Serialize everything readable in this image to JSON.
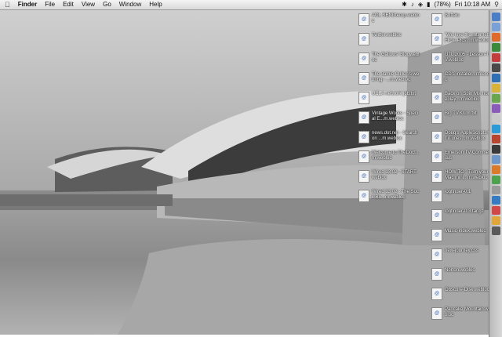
{
  "menubar": {
    "app_name": "Finder",
    "menus": [
      "File",
      "Edit",
      "View",
      "Go",
      "Window",
      "Help"
    ],
    "battery": "(78%)",
    "clock": "Fri 10:18 AM"
  },
  "desktop_icons": [
    {
      "name": "AOL SENDtemp.webloc",
      "col": 0,
      "row": 0
    },
    {
      "name": "Twitter.webloc",
      "col": 0,
      "row": 1
    },
    {
      "name": "The Gallows' Blogwebloc",
      "col": 0,
      "row": 2
    },
    {
      "name": "The Jamie Cullen's webring - ...m.webloc",
      "col": 0,
      "row": 3
    },
    {
      "name": "UCLA network job.txt",
      "col": 0,
      "row": 4
    },
    {
      "name": "Vintage Works - Special E...m.webloc",
      "col": 0,
      "row": 5
    },
    {
      "name": "news.dot.net - Search on ...m.webloc",
      "col": 0,
      "row": 6
    },
    {
      "name": "Welcome to TheDoct...m.webloc",
      "col": 0,
      "row": 7
    },
    {
      "name": "Wired 13.02 - START.webloc",
      "col": 0,
      "row": 8
    },
    {
      "name": "Wired 13.02 - The Sock Bu...m.webloc",
      "col": 0,
      "row": 9
    },
    {
      "name": "Buffalo",
      "col": 1,
      "row": 0
    },
    {
      "name": "\"We love the internet\" Flickr Pics...m.webloc",
      "col": 1,
      "row": 1
    },
    {
      "name": "UTL 2005 - Lesson-TV.webloc",
      "col": 1,
      "row": 2
    },
    {
      "name": "CD's installer...nfiler.doc",
      "col": 1,
      "row": 3
    },
    {
      "name": "Back on Spin Mix homeplay...m.webloc",
      "col": 1,
      "row": 4
    },
    {
      "name": "Big TV.Klum.txt",
      "col": 1,
      "row": 5
    },
    {
      "name": "Doug's AppleScripts for iTunes...m.webloc",
      "col": 1,
      "row": 6
    },
    {
      "name": "Emerson TV Commercials",
      "col": 1,
      "row": 7
    },
    {
      "name": "HOW-TO - Turn your Mac mini...m.webloc",
      "col": 1,
      "row": 8
    },
    {
      "name": "logfinder-0.1",
      "col": 1,
      "row": 9
    },
    {
      "name": "logfinder-0.3.tar.gz",
      "col": 1,
      "row": 10
    },
    {
      "name": "Music-index.webloc",
      "col": 1,
      "row": 11
    },
    {
      "name": "new-journey.css",
      "col": 1,
      "row": 12
    },
    {
      "name": "Norton.webloc",
      "col": 1,
      "row": 13
    },
    {
      "name": "Obscure-Disk.webloc",
      "col": 1,
      "row": 14
    },
    {
      "name": "Pancake Mountain.webloc",
      "col": 1,
      "row": 15
    }
  ],
  "dock_colors": [
    "#4a7fc7",
    "#7aa0d8",
    "#e06a2a",
    "#3b8a3b",
    "#c43d3d",
    "#4a4a4a",
    "#2f6fb5",
    "#d8b33a",
    "#6aa64e",
    "#8a5bb8",
    "#c9c9c9",
    "#2c9ad6",
    "#b8452f",
    "#3a3a3a",
    "#6f96c9",
    "#d97b2b",
    "#4da34d",
    "#9a9a9a",
    "#357bc2",
    "#d04848",
    "#e0a63a",
    "#5a5a5a"
  ]
}
